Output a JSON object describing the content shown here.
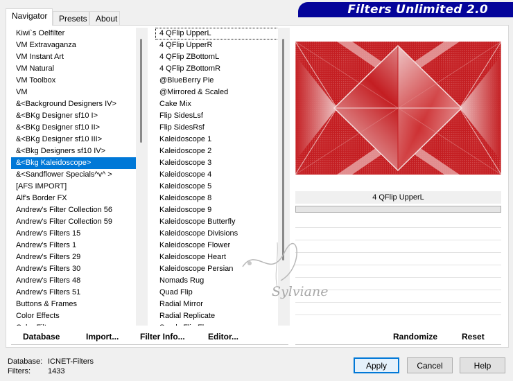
{
  "banner": {
    "title": "Filters Unlimited 2.0"
  },
  "tabs": [
    {
      "label": "Navigator",
      "active": true
    },
    {
      "label": "Presets",
      "active": false
    },
    {
      "label": "About",
      "active": false
    }
  ],
  "categories": {
    "selected_index": 11,
    "items": [
      "Kiwi`s Oelfilter",
      "VM Extravaganza",
      "VM Instant Art",
      "VM Natural",
      "VM Toolbox",
      "VM",
      "&<Background Designers IV>",
      "&<BKg Designer sf10 I>",
      "&<BKg Designer sf10 II>",
      "&<BKg Designer sf10 III>",
      "&<Bkg Designers sf10 IV>",
      "&<Bkg Kaleidoscope>",
      "&<Sandflower Specials^v^ >",
      "[AFS IMPORT]",
      "Alf's Border FX",
      "Andrew's Filter Collection 56",
      "Andrew's Filter Collection 59",
      "Andrew's Filters 15",
      "Andrew's Filters 1",
      "Andrew's Filters 29",
      "Andrew's Filters 30",
      "Andrew's Filters 48",
      "Andrew's Filters 51",
      "Buttons & Frames",
      "Color Effects",
      "Color Filters"
    ]
  },
  "filters": {
    "selected_index": 0,
    "items": [
      "4 QFlip UpperL",
      "4 QFlip UpperR",
      "4 QFlip ZBottomL",
      "4 QFlip ZBottomR",
      "@BlueBerry Pie",
      "@Mirrored & Scaled",
      "Cake Mix",
      "Flip SidesLsf",
      "Flip SidesRsf",
      "Kaleidoscope 1",
      "Kaleidoscope 2",
      "Kaleidoscope 3",
      "Kaleidoscope 4",
      "Kaleidoscope 5",
      "Kaleidoscope 8",
      "Kaleidoscope 9",
      "Kaleidoscope Butterfly",
      "Kaleidoscope Divisions",
      "Kaleidoscope Flower",
      "Kaleidoscope Heart",
      "Kaleidoscope Persian",
      "Nomads Rug",
      "Quad Flip",
      "Radial Mirror",
      "Radial Replicate",
      "Seeds Flip Flop"
    ]
  },
  "preview": {
    "filter_name": "4 QFlip UpperL",
    "colors": {
      "red": "#c41e22",
      "light": "#f2d8d8",
      "mid": "#dd7a7c"
    }
  },
  "watermark": {
    "text": "Sylviane"
  },
  "actions": {
    "database": "Database",
    "import": "Import...",
    "filter_info": "Filter Info...",
    "editor": "Editor...",
    "randomize": "Randomize",
    "reset": "Reset"
  },
  "status": {
    "database_label": "Database:",
    "database_value": "ICNET-Filters",
    "filters_label": "Filters:",
    "filters_value": "1433"
  },
  "buttons": {
    "apply": "Apply",
    "cancel": "Cancel",
    "help": "Help"
  },
  "accent": "#0078d7",
  "banner_color": "#05049a"
}
